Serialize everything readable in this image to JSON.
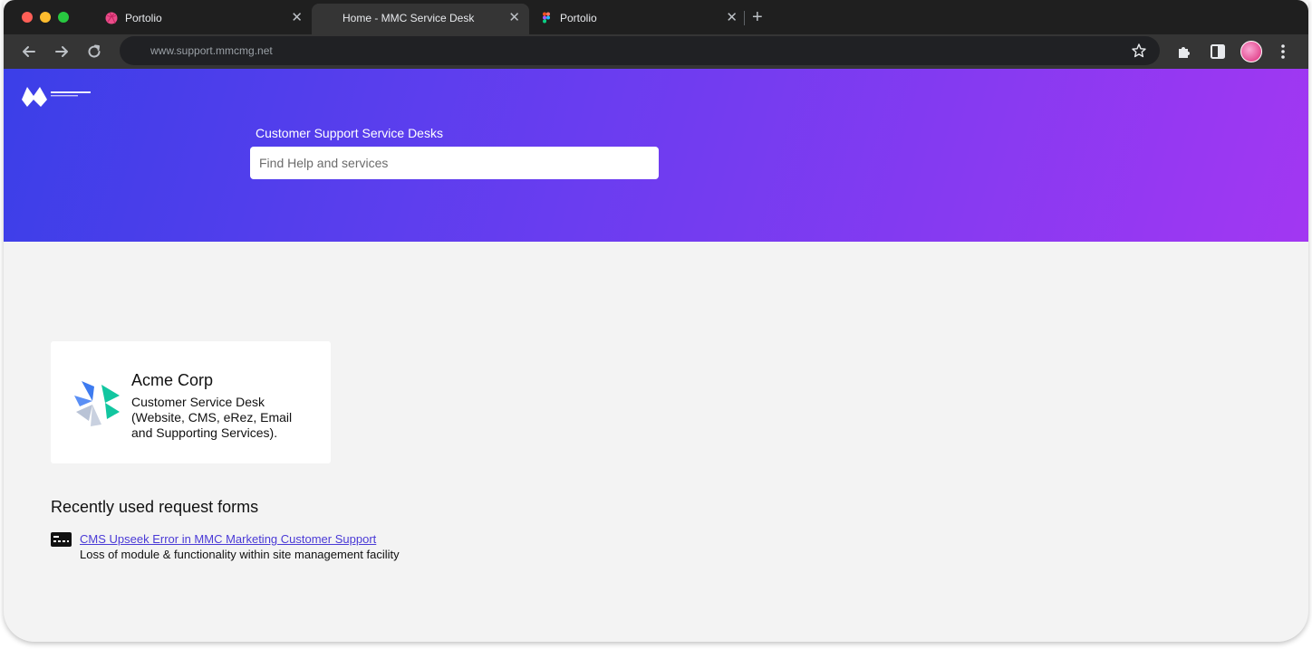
{
  "browser": {
    "tabs": [
      {
        "title": "Portolio",
        "favicon": "dribbble-icon",
        "active": false
      },
      {
        "title": "Home - MMC Service Desk",
        "favicon": "",
        "active": true
      },
      {
        "title": "Portolio",
        "favicon": "figma-icon",
        "active": false
      }
    ],
    "close_glyph": "✕",
    "newtab_glyph": "+",
    "url": "www.support.mmcmg.net"
  },
  "hero": {
    "title": "Customer Support Service Desks",
    "search_placeholder": "Find Help and services",
    "gradient": [
      "#3b3fe8",
      "#a237f2"
    ]
  },
  "service_desk": {
    "name": "Acme Corp",
    "description": "Customer Service Desk (Website, CMS, eRez, Email and Supporting Services)."
  },
  "recent": {
    "heading": "Recently used request forms",
    "forms": [
      {
        "title": "CMS Upseek Error in MMC Marketing Customer Support",
        "description": "Loss of module & functionality within site management facility",
        "icon": "terminal-icon"
      }
    ]
  },
  "colors": {
    "link": "#4a3ad6",
    "tab_bar": "#1f1f1f",
    "toolbar": "#353535"
  }
}
